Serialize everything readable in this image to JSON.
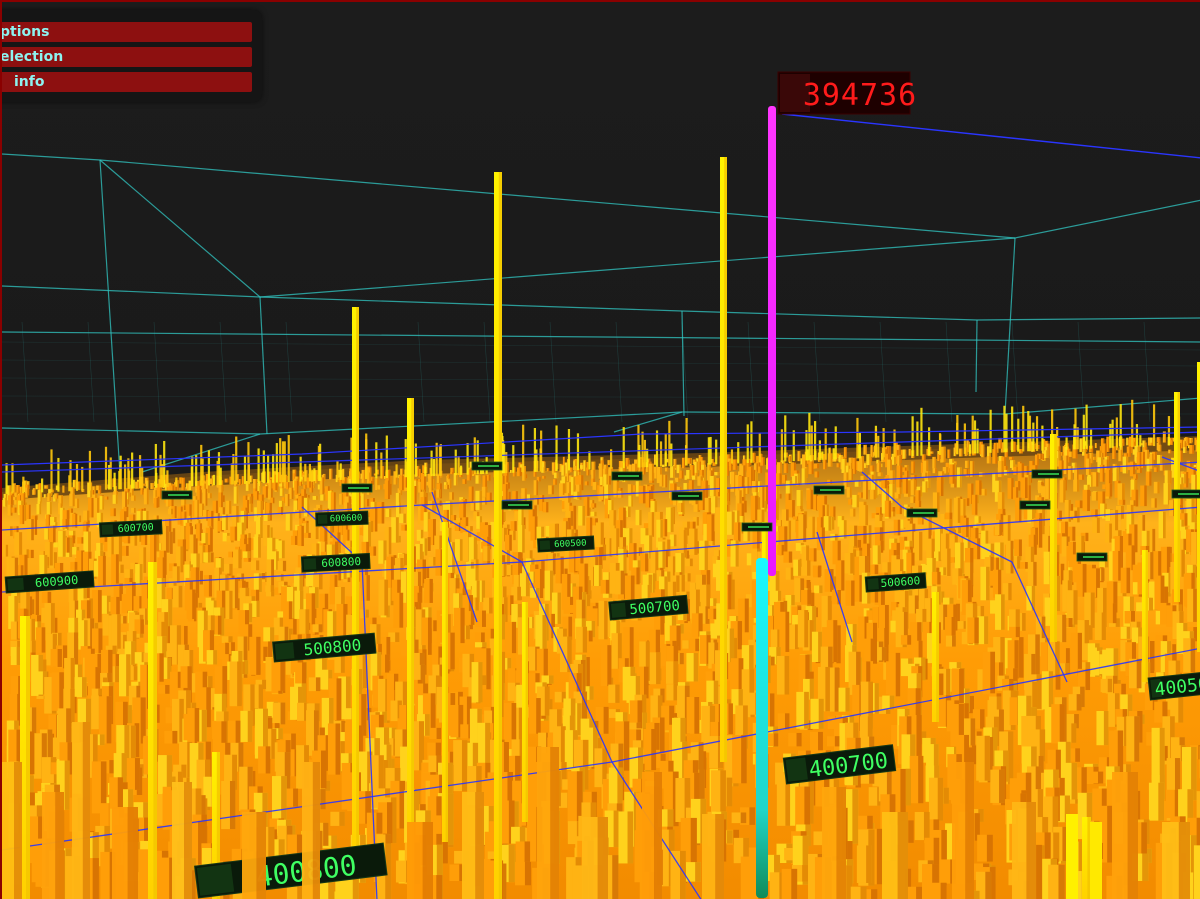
{
  "menu": {
    "items": [
      {
        "label": "ptions"
      },
      {
        "label": "election"
      },
      {
        "label": "info"
      }
    ]
  },
  "highlight": {
    "value_label": "394736",
    "label_color": "#ff1b1b",
    "bar_color": "#ff1cff",
    "lower_color": "#18f0ff",
    "base_color": "#0fa86d"
  },
  "grid_labels": [
    {
      "text": "400800"
    },
    {
      "text": "400700"
    },
    {
      "text": "500800"
    },
    {
      "text": "500700"
    },
    {
      "text": "500600"
    },
    {
      "text": "600900"
    },
    {
      "text": "600800"
    },
    {
      "text": "600700"
    },
    {
      "text": "600600"
    },
    {
      "text": "600500"
    },
    {
      "text": "40050"
    }
  ],
  "colors": {
    "background": "#1b1b1b",
    "terrain_light": "#ffb020",
    "terrain_dark": "#d86d00",
    "spike": "#fff000",
    "grid_blue": "#2a35ff",
    "room_cyan": "#31c7c3",
    "label_green": "#3fff62"
  }
}
